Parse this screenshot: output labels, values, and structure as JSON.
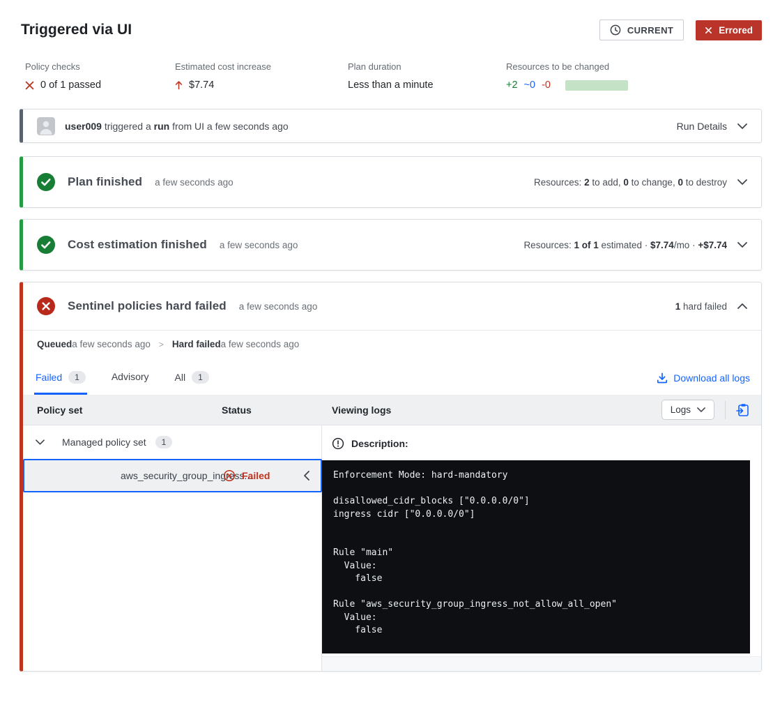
{
  "page_title": "Triggered via UI",
  "header": {
    "current_label": "CURRENT",
    "errored_label": "Errored"
  },
  "stats": {
    "policy_checks_label": "Policy checks",
    "policy_checks_value": "0 of 1 passed",
    "cost_label": "Estimated cost increase",
    "cost_value": "$7.74",
    "duration_label": "Plan duration",
    "duration_value": "Less than a minute",
    "resources_label": "Resources to be changed",
    "resources_add": "+2",
    "resources_change": "~0",
    "resources_destroy": "-0"
  },
  "trigger": {
    "user": "user009",
    "mid1": " triggered a ",
    "run": "run",
    "mid2": " from UI a few seconds ago",
    "details_label": "Run Details"
  },
  "plan": {
    "title": "Plan finished",
    "time": "a few seconds ago",
    "s1": "Resources: ",
    "b1": "2",
    "s2": " to add, ",
    "b2": "0",
    "s3": " to change, ",
    "b3": "0",
    "s4": " to destroy"
  },
  "cost": {
    "title": "Cost estimation finished",
    "time": "a few seconds ago",
    "s1": "Resources: ",
    "b1": "1 of 1",
    "s2": " estimated · ",
    "b2": "$7.74",
    "s3": "/mo · ",
    "b3": "+$7.74"
  },
  "sentinel": {
    "title": "Sentinel policies hard failed",
    "time": "a few seconds ago",
    "count": "1",
    "count_suffix": " hard failed",
    "queued_label": "Queued",
    "queued_time": " a few seconds ago",
    "sep": ">",
    "hardfailed_label": "Hard failed",
    "hardfailed_time": " a few seconds ago",
    "tabs": {
      "failed": "Failed",
      "failed_count": "1",
      "advisory": "Advisory",
      "all": "All",
      "all_count": "1"
    },
    "download_label": "Download all logs",
    "table": {
      "col_policy_set": "Policy set",
      "col_status": "Status",
      "col_viewing_logs": "Viewing logs",
      "logs_dropdown": "Logs",
      "group_name": "Managed policy set",
      "group_count": "1",
      "policy_name": "aws_security_group_ingress...",
      "policy_status": "Failed"
    },
    "log": {
      "description_label": "Description:",
      "text": "Enforcement Mode: hard-mandatory\n\ndisallowed_cidr_blocks [\"0.0.0.0/0\"]\ningress cidr [\"0.0.0.0/0\"]\n\n\nRule \"main\"\n  Value:\n    false\n\nRule \"aws_security_group_ingress_not_allow_all_open\"\n  Value:\n    false"
    }
  },
  "colors": {
    "accent_blue": "#1563ff",
    "success_green": "#187e36",
    "success_border": "#259c43",
    "danger_red": "#c0331f",
    "errored_bg": "#bb342a",
    "neutral_border": "#5a626e",
    "bar_green": "#c3e2c6",
    "terminal_bg": "#0d0f13",
    "selected_bg": "#eef0f2",
    "header_bg": "#eef0f2"
  }
}
